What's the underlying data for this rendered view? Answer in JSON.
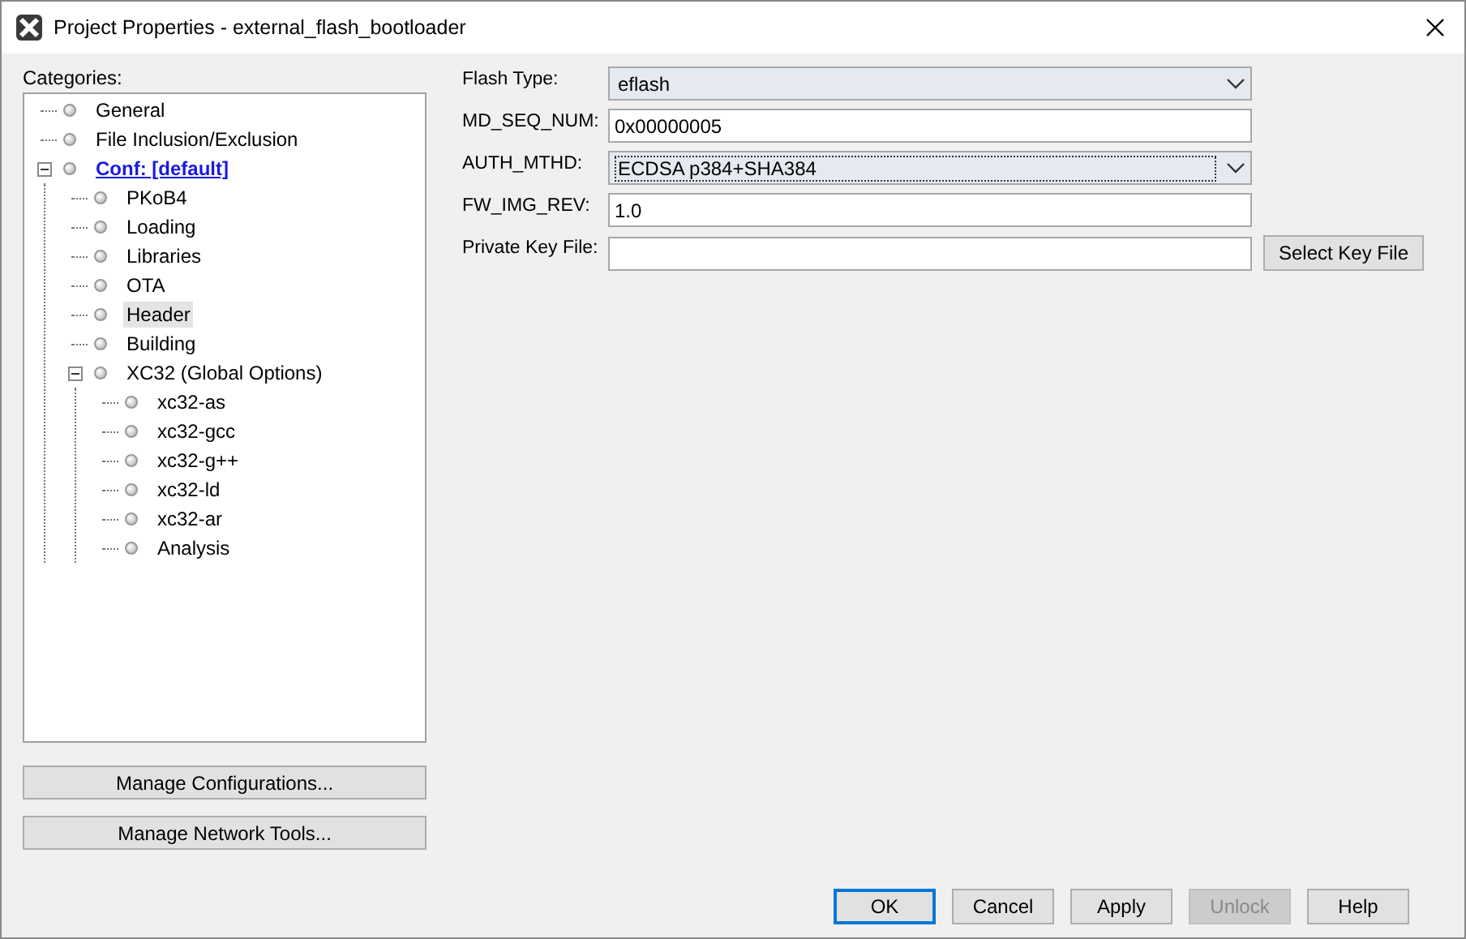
{
  "window": {
    "title": "Project Properties - external_flash_bootloader"
  },
  "categories": {
    "label": "Categories:",
    "items": [
      {
        "label": "General",
        "selected": false,
        "active": false
      },
      {
        "label": "File Inclusion/Exclusion",
        "selected": false,
        "active": false
      },
      {
        "label": "Conf: [default]",
        "selected": false,
        "active": true,
        "expanded": true,
        "children": [
          {
            "label": "PKoB4",
            "selected": false,
            "active": false
          },
          {
            "label": "Loading",
            "selected": false,
            "active": false
          },
          {
            "label": "Libraries",
            "selected": false,
            "active": false
          },
          {
            "label": "OTA",
            "selected": false,
            "active": false
          },
          {
            "label": "Header",
            "selected": true,
            "active": false
          },
          {
            "label": "Building",
            "selected": false,
            "active": false
          },
          {
            "label": "XC32 (Global Options)",
            "selected": false,
            "active": false,
            "expanded": true,
            "children": [
              {
                "label": "xc32-as",
                "selected": false,
                "active": false
              },
              {
                "label": "xc32-gcc",
                "selected": false,
                "active": false
              },
              {
                "label": "xc32-g++",
                "selected": false,
                "active": false
              },
              {
                "label": "xc32-ld",
                "selected": false,
                "active": false
              },
              {
                "label": "xc32-ar",
                "selected": false,
                "active": false
              },
              {
                "label": "Analysis",
                "selected": false,
                "active": false
              }
            ]
          }
        ]
      }
    ]
  },
  "side_buttons": [
    "Manage Configurations...",
    "Manage Network Tools..."
  ],
  "fields": [
    {
      "kind": "dropdown",
      "label": "Flash Type:",
      "value": "eflash",
      "focused": false
    },
    {
      "kind": "text",
      "label": "MD_SEQ_NUM:",
      "value": "0x00000005"
    },
    {
      "kind": "dropdown",
      "label": "AUTH_MTHD:",
      "value": "ECDSA p384+SHA384",
      "focused": true
    },
    {
      "kind": "text",
      "label": "FW_IMG_REV:",
      "value": "1.0"
    },
    {
      "kind": "file",
      "label": "Private Key File:",
      "button": "Select Key File"
    }
  ],
  "buttons": [
    {
      "label": "OK",
      "default": true,
      "disabled": false
    },
    {
      "label": "Cancel",
      "default": false,
      "disabled": false
    },
    {
      "label": "Apply",
      "default": false,
      "disabled": false
    },
    {
      "label": "Unlock",
      "default": false,
      "disabled": true
    },
    {
      "label": "Help",
      "default": false,
      "disabled": false
    }
  ]
}
